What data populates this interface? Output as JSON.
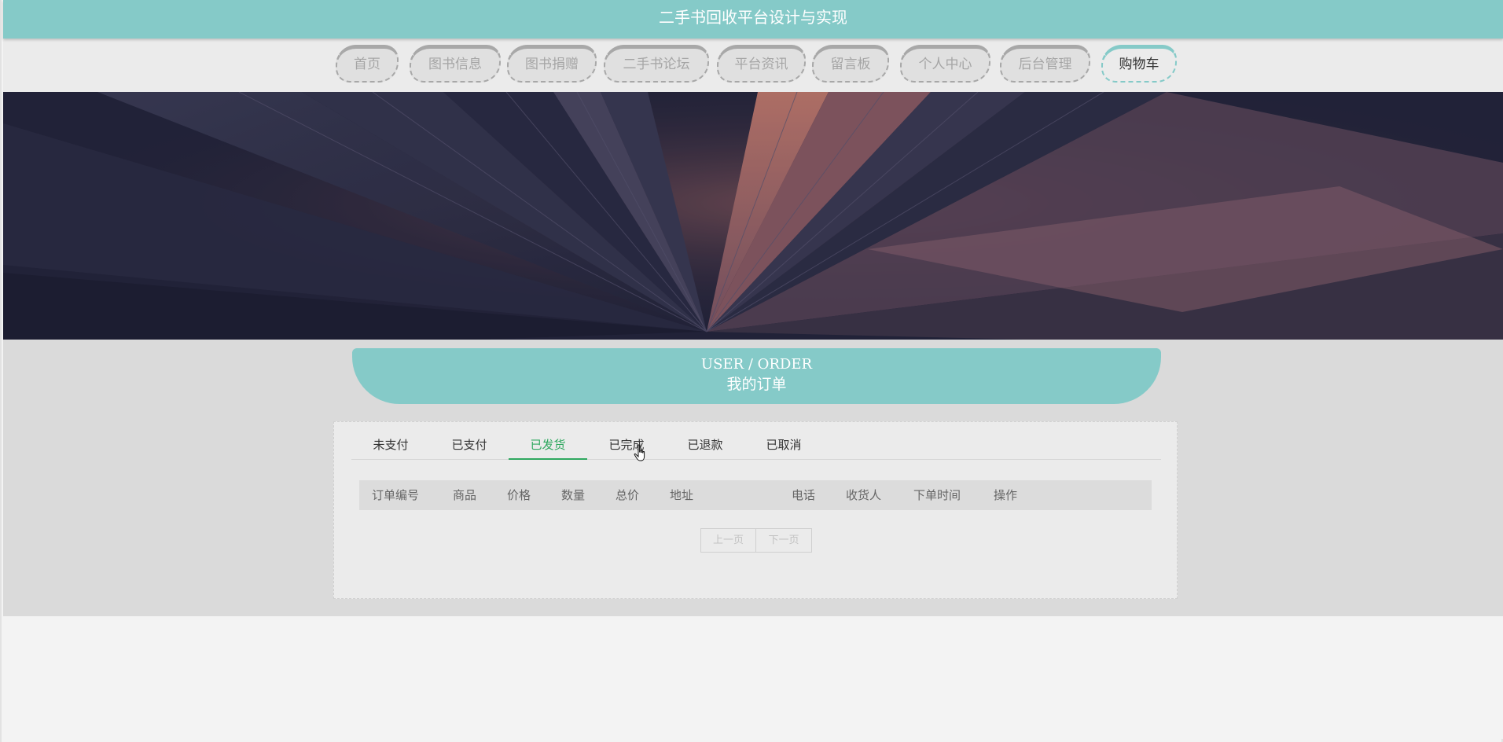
{
  "site_title": "二手书回收平台设计与实现",
  "nav": {
    "items": [
      {
        "label": "首页"
      },
      {
        "label": "图书信息"
      },
      {
        "label": "图书捐赠"
      },
      {
        "label": "二手书论坛"
      },
      {
        "label": "平台资讯"
      },
      {
        "label": "留言板"
      },
      {
        "label": "个人中心"
      },
      {
        "label": "后台管理"
      },
      {
        "label": "购物车",
        "active": true
      }
    ]
  },
  "banner": {
    "image": "open-book-photo"
  },
  "section": {
    "title_en": "USER / ORDER",
    "title_cn": "我的订单"
  },
  "tabs": [
    {
      "label": "未支付"
    },
    {
      "label": "已支付"
    },
    {
      "label": "已发货",
      "active": true
    },
    {
      "label": "已完成"
    },
    {
      "label": "已退款"
    },
    {
      "label": "已取消"
    }
  ],
  "table": {
    "columns": [
      "订单编号",
      "商品",
      "价格",
      "数量",
      "总价",
      "地址",
      "电话",
      "收货人",
      "下单时间",
      "操作"
    ],
    "rows": []
  },
  "pager": {
    "prev_label": "上一页",
    "next_label": "下一页"
  },
  "colors": {
    "accent": "#85cac8",
    "active_tab": "#2fa85f"
  }
}
